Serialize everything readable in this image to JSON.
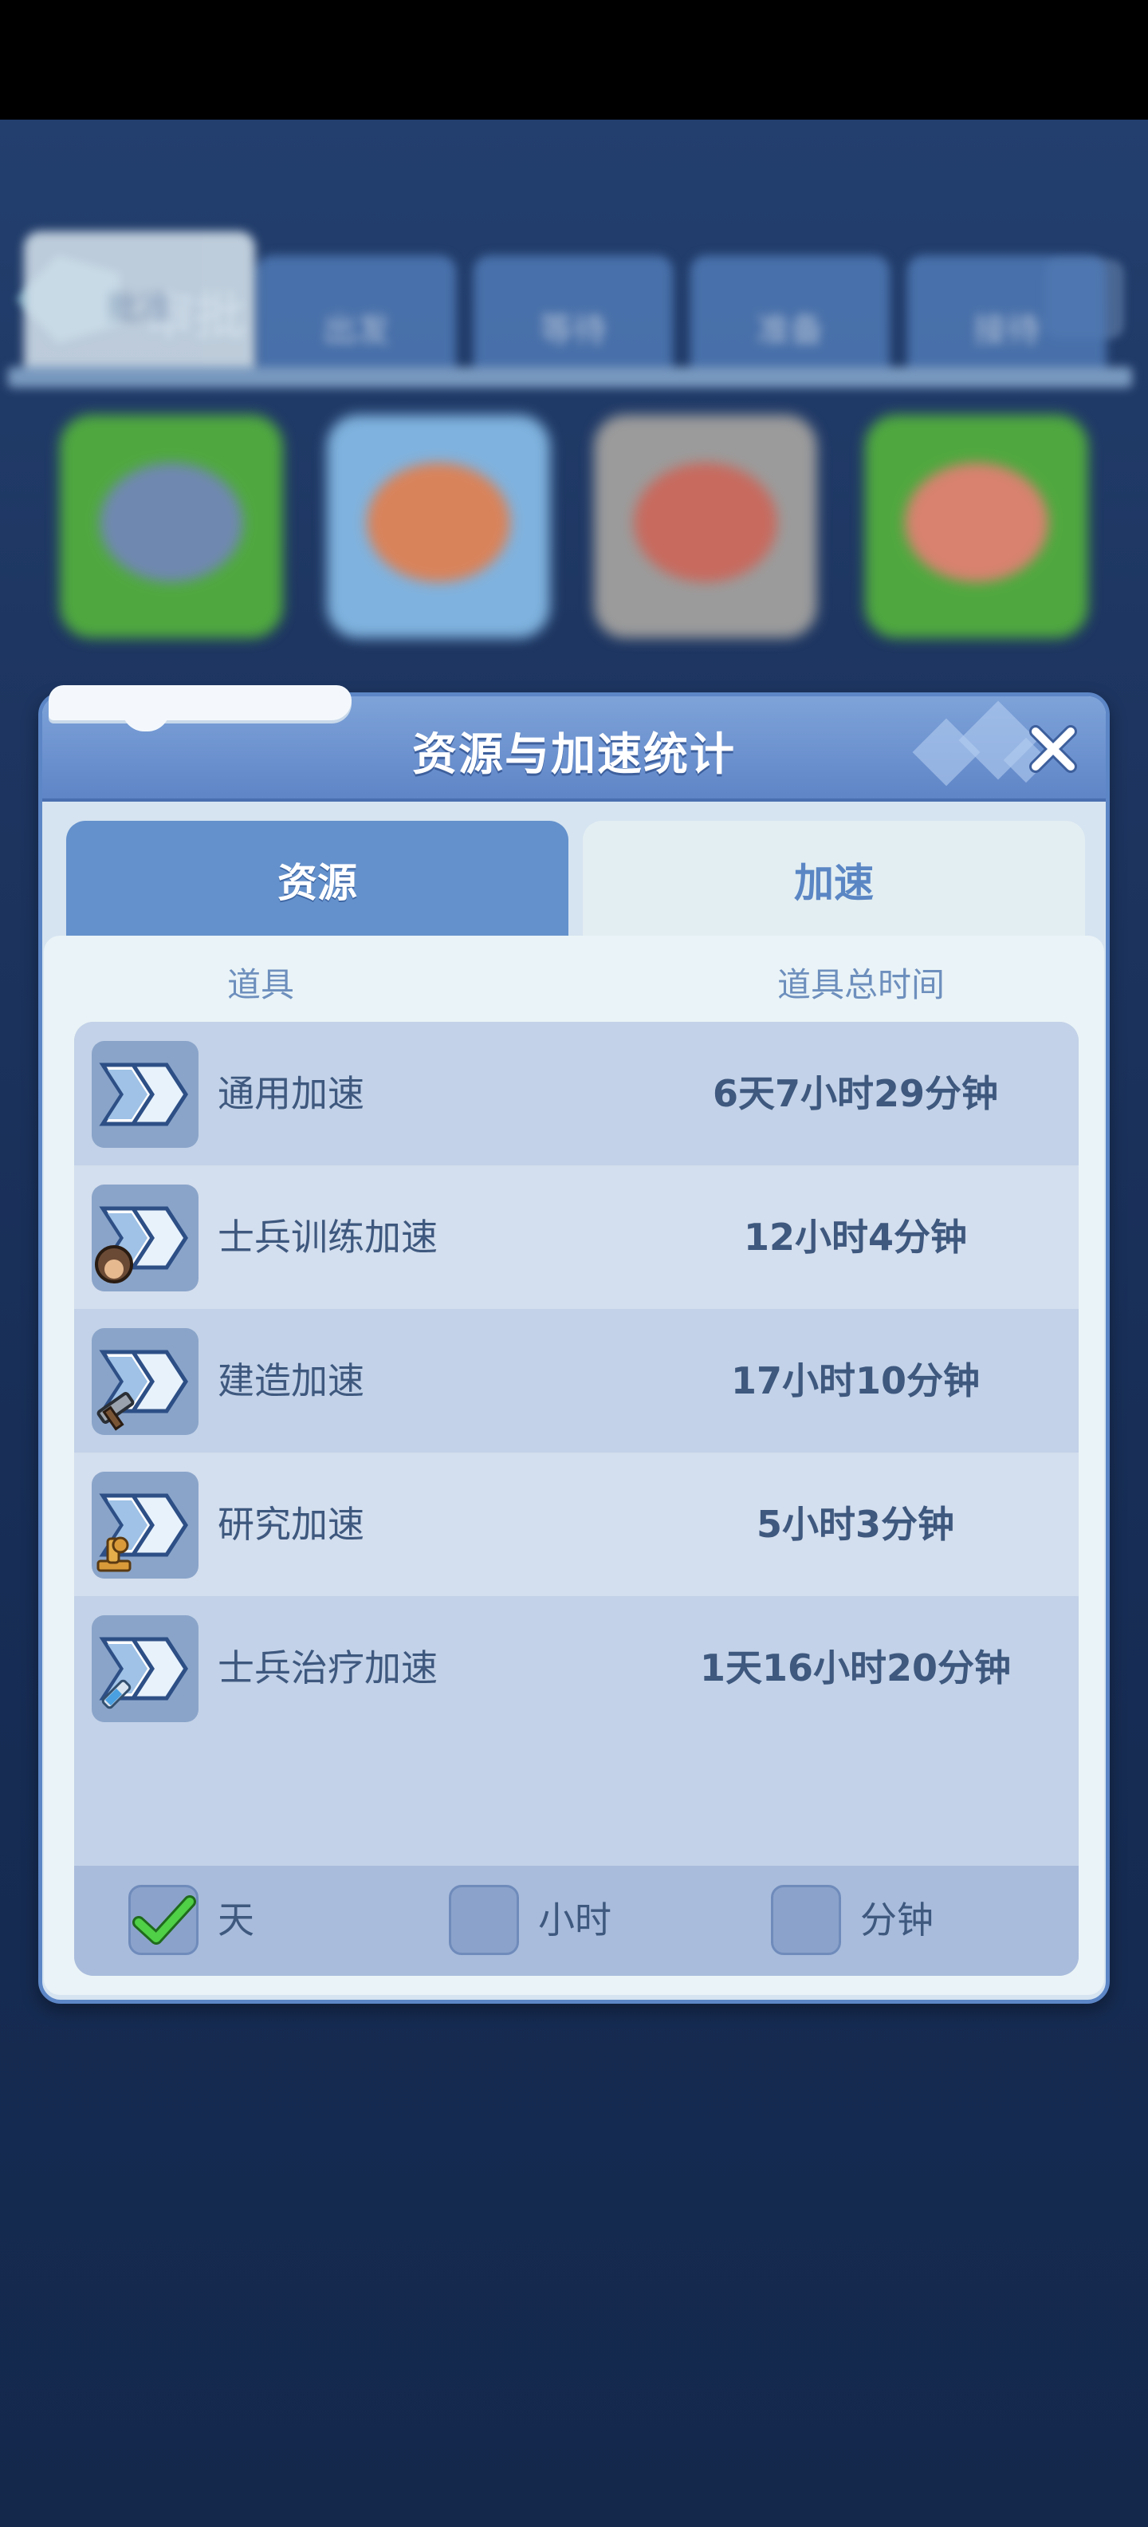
{
  "background_screen": {
    "title": "审批",
    "tabs": [
      "批准",
      "出发",
      "等待",
      "准备",
      "接待"
    ]
  },
  "dialog": {
    "title": "资源与加速统计",
    "close_icon": "close-icon",
    "tabs": [
      {
        "label": "资源",
        "active": false
      },
      {
        "label": "加速",
        "active": true
      }
    ],
    "columns": {
      "item": "道具",
      "total_time": "道具总时间"
    },
    "rows": [
      {
        "icon": "general-speedup-icon",
        "name": "通用加速",
        "time": "6天7小时29分钟"
      },
      {
        "icon": "troop-training-speedup-icon",
        "name": "士兵训练加速",
        "time": "12小时4分钟"
      },
      {
        "icon": "construction-speedup-icon",
        "name": "建造加速",
        "time": "17小时10分钟"
      },
      {
        "icon": "research-speedup-icon",
        "name": "研究加速",
        "time": "5小时3分钟"
      },
      {
        "icon": "healing-speedup-icon",
        "name": "士兵治疗加速",
        "time": "1天16小时20分钟"
      }
    ],
    "unit_options": [
      {
        "label": "天",
        "checked": true
      },
      {
        "label": "小时",
        "checked": false
      },
      {
        "label": "分钟",
        "checked": false
      }
    ]
  },
  "colors": {
    "page_bg": "#15284d",
    "dialog_header": "#6b90d0",
    "accent_green": "#3fbf3a",
    "text": "#3e587e"
  }
}
